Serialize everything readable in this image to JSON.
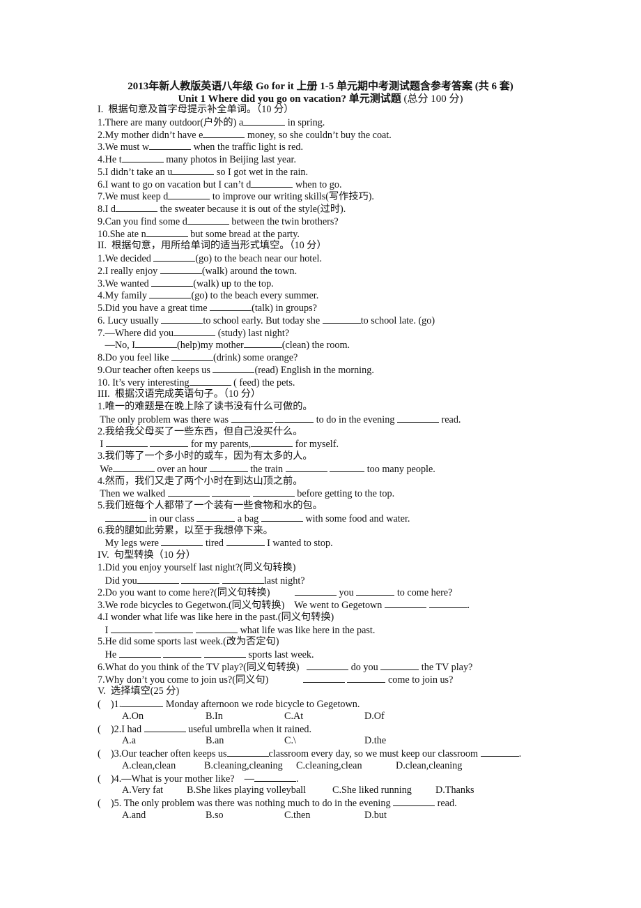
{
  "header": {
    "title": "2013年新人教版英语八年级 Go for it 上册 1-5 单元期中考测试题含参考答案 (共 6 套)",
    "subtitle_unit": "Unit 1    Where did you go on vacation? 单元测试题",
    "subtitle_score": " (总分 100 分)"
  },
  "sections": [
    {
      "heading": "I.  根据句意及首字母提示补全单词。（10 分）",
      "lines": [
        [
          "1.There are many outdoor(户外的) a",
          " in spring."
        ],
        [
          "2.My mother didn’t have e",
          " money, so she couldn’t buy the coat."
        ],
        [
          "3.We must w",
          " when the traffic light is red."
        ],
        [
          "4.He t",
          " many photos in Beijing last year."
        ],
        [
          "5.I didn’t take an u",
          " so I got wet in the rain."
        ],
        [
          "6.I want to go on vacation but I can’t d",
          " when to go."
        ],
        [
          "7.We must keep d",
          " to improve our writing skills(写作技巧)."
        ],
        [
          "8.I d",
          " the sweater because it is out of the style(过时)."
        ],
        [
          "9.Can you find some d",
          " between the twin brothers?"
        ],
        [
          "10.She ate n",
          " but some bread at the party."
        ]
      ]
    },
    {
      "heading": "II.  根据句意，用所给单词的适当形式填空。（10 分）",
      "lines": [
        [
          "1.We decided ",
          "(go) to the beach near our hotel."
        ],
        [
          "2.I really enjoy ",
          "(walk) around the town."
        ],
        [
          "3.We wanted ",
          "(walk) up to the top."
        ],
        [
          "4.My family ",
          "(go) to the beach every summer."
        ],
        [
          "5.Did you have a great time ",
          "(talk) in groups?"
        ],
        [
          "6. Lucy usually ",
          "to school early. But today she ",
          "to school late. (go)"
        ],
        [
          "7.—Where did you",
          " (study) last night?"
        ],
        [
          "   —No, I",
          "(help)my mother",
          "(clean) the room."
        ],
        [
          "8.Do you feel like ",
          "(drink) some orange?"
        ],
        [
          "9.Our teacher often keeps us ",
          "(read) English in the morning."
        ],
        [
          "10. It’s very interesting",
          " ( feed) the pets."
        ]
      ]
    },
    {
      "heading": "III.  根据汉语完成英语句子。（10 分）",
      "lines": [
        [
          "1.唯一的难题是在晚上除了读书没有什么可做的。"
        ],
        [
          " The only problem was there was ",
          " ",
          " to do in the evening ",
          " read."
        ],
        [
          "2.我给我父母买了一些东西，但自己没买什么。"
        ],
        [
          " I ",
          " ",
          " for my parents,",
          " for myself."
        ],
        [
          "3.我们等了一个多小时的或车，因为有太多的人。"
        ],
        [
          " We",
          " over an hour ",
          " the train ",
          " ",
          " too many people."
        ],
        [
          "4.然而，我们又走了两个小时在到达山顶之前。"
        ],
        [
          " Then we walked ",
          " ",
          " ",
          " before getting to the top."
        ],
        [
          "5.我们班每个人都带了一个装有一些食物和水的包。"
        ],
        [
          "   ",
          " in our class ",
          " a bag ",
          " with some food and water."
        ],
        [
          "6.我的腿如此劳累，以至于我想停下来。"
        ],
        [
          "   My legs were ",
          " tired ",
          " I wanted to stop."
        ]
      ]
    },
    {
      "heading": "IV.  句型转换（10 分）",
      "lines": [
        [
          "1.Did you enjoy yourself last night?(同义句转换)"
        ],
        [
          "   Did you",
          " ",
          " ",
          "last night?"
        ],
        [
          "2.Do you want to come here?(同义句转换)          ",
          " you ",
          " to come here?"
        ],
        [
          "3.We rode bicycles to Gegetwon.(同义句转换)    We went to Gegetown ",
          " ",
          "."
        ],
        [
          "4.I wonder what life was like here in the past.(同义句转换)"
        ],
        [
          "   I ",
          " ",
          " ",
          " what life was like here in the past."
        ],
        [
          "5.He did some sports last week.(改为否定句)"
        ],
        [
          "   He ",
          " ",
          " ",
          " sports last week."
        ],
        [
          "6.What do you think of the TV play?(同义句转换)   ",
          " do you ",
          " the TV play?"
        ],
        [
          "7.Why don’t you come to join us?(同义句)              ",
          " ",
          " come to join us?"
        ]
      ]
    },
    {
      "heading": "V.  选择填空(25 分)",
      "questions": [
        {
          "stem": [
            "(    )1.",
            " Monday afternoon we rode bicycle to Gegetown."
          ],
          "options": [
            "A.On",
            "B.In",
            "C.At",
            "D.Of"
          ]
        },
        {
          "stem": [
            "(    )2.I had ",
            " useful umbrella when it rained."
          ],
          "options": [
            "A.a",
            "B.an",
            "C.\\",
            "D.the"
          ]
        },
        {
          "stem": [
            "(    )3.Our teacher often keeps us",
            "classroom every day, so we must keep our classroom ",
            "."
          ],
          "options": [
            "A.clean,clean",
            "B.cleaning,cleaning",
            "C.cleaning,clean",
            "D.clean,cleaning"
          ]
        },
        {
          "stem": [
            "(    )4.—What is your mother like?    —",
            "."
          ],
          "options": [
            "A.Very fat",
            "B.She likes playing volleyball",
            "C.She liked running",
            "D.Thanks"
          ]
        },
        {
          "stem": [
            "(    )5. The only problem was there was nothing much to do in the evening ",
            " read."
          ],
          "options": [
            "A.and",
            "B.so",
            "C.then",
            "D.but"
          ]
        }
      ]
    }
  ]
}
